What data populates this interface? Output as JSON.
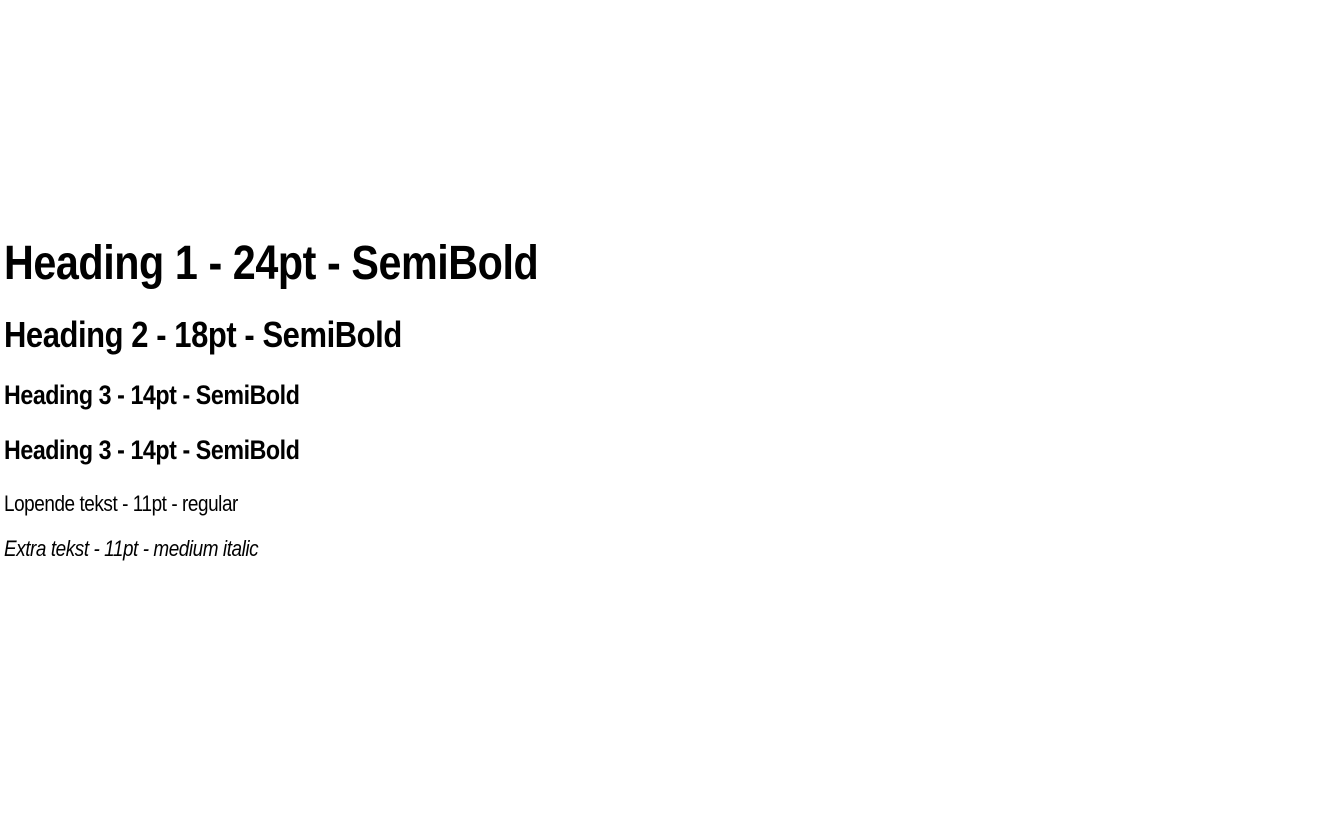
{
  "typography": {
    "heading1": "Heading 1 - 24pt - SemiBold",
    "heading2": "Heading 2 - 18pt - SemiBold",
    "heading3_first": "Heading 3 - 14pt - SemiBold",
    "heading3_second": "Heading 3 - 14pt - SemiBold",
    "body_text": "Lopende tekst - 11pt - regular",
    "extra_text": "Extra tekst - 11pt - medium italic"
  },
  "colors": {
    "background": "#ffffff",
    "text": "#000000"
  }
}
